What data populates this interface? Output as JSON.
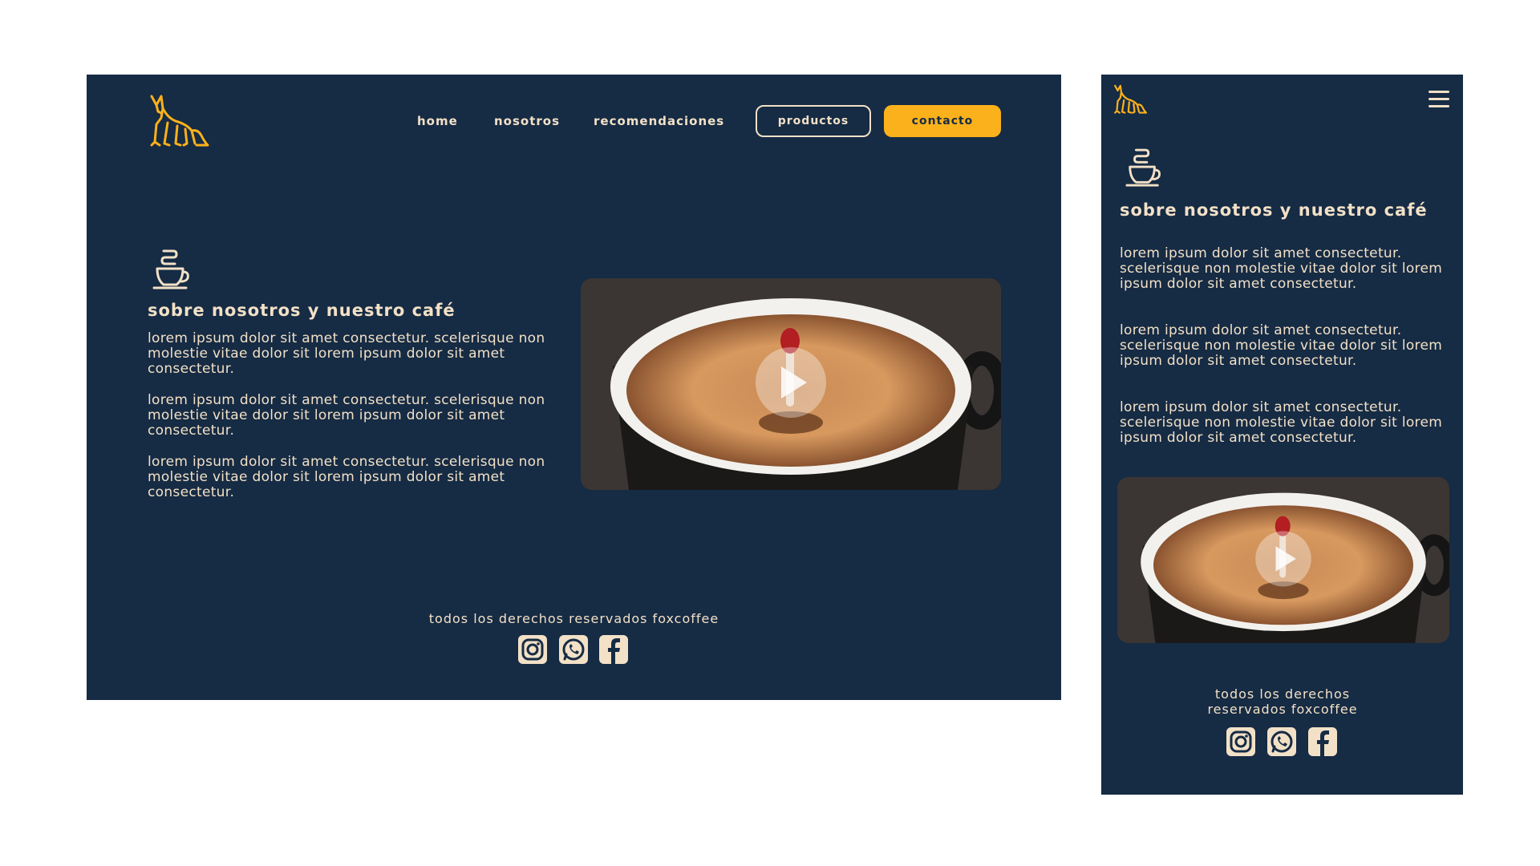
{
  "brand": {
    "name": "foxcoffee",
    "accent": "#fbb11b",
    "background": "#162b44",
    "text": "#f2e1c7",
    "logo_icon": "fox-icon"
  },
  "nav": {
    "home": "Home",
    "nosotros": "Nosotros",
    "recomendaciones": "recomendaciones",
    "productos": "Productos",
    "contacto": "contacto"
  },
  "about": {
    "icon": "coffee-cup-icon",
    "title": "sobre nosotros y nuestro café",
    "paragraphs": [
      "Lorem ipsum dolor sit amet consectetur. Scelerisque non molestie vitae dolor sit Lorem ipsum dolor sit amet consectetur.",
      "Lorem ipsum dolor sit amet consectetur. Scelerisque non molestie vitae dolor sit Lorem ipsum dolor sit amet consectetur.",
      "Lorem ipsum dolor sit amet consectetur. Scelerisque non molestie vitae dolor sit Lorem ipsum dolor sit amet consectetur."
    ]
  },
  "video": {
    "icon": "play-icon"
  },
  "footer": {
    "copyright": "TODOS LOS DERECHOS RESERVADOS FOXCOFFEE",
    "social": [
      "instagram-icon",
      "whatsapp-icon",
      "facebook-icon"
    ]
  },
  "mobile": {
    "menu_icon": "hamburger-menu-icon"
  }
}
